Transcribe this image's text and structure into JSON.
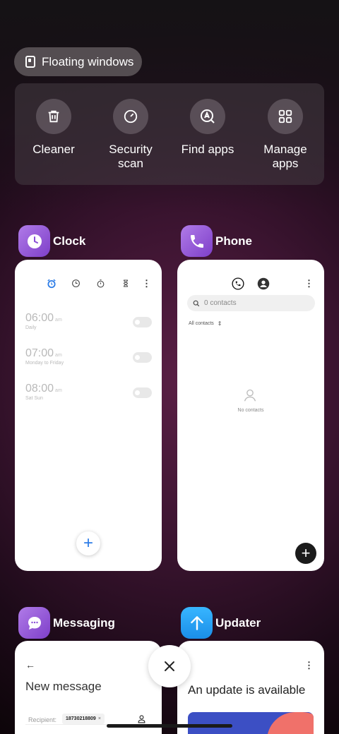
{
  "floating_windows": {
    "label": "Floating windows"
  },
  "tools": [
    {
      "label": "Cleaner",
      "icon": "trash-icon"
    },
    {
      "label": "Security scan",
      "line1": "Security",
      "line2": "scan",
      "icon": "security-scan-icon"
    },
    {
      "label": "Find apps",
      "icon": "find-apps-icon"
    },
    {
      "label": "Manage apps",
      "line1": "Manage",
      "line2": "apps",
      "icon": "grid-icon"
    }
  ],
  "clock": {
    "app_name": "Clock",
    "icon_color": "#9b5cd8",
    "alarms": [
      {
        "time": "06:00",
        "ampm": "am",
        "repeat": "Daily"
      },
      {
        "time": "07:00",
        "ampm": "am",
        "repeat": "Monday to Friday"
      },
      {
        "time": "08:00",
        "ampm": "am",
        "repeat": "Sat Sun"
      }
    ],
    "add_label": "+",
    "more_label": "⋮"
  },
  "phone": {
    "app_name": "Phone",
    "icon_color": "#9b5cd8",
    "search_placeholder": "0 contacts",
    "filter_label": "All contacts",
    "empty_label": "No contacts",
    "add_label": "+",
    "more_label": "⋮"
  },
  "messaging": {
    "app_name": "Messaging",
    "icon_color": "#9b5cd8",
    "title": "New message",
    "recipient_label": "Recipient:",
    "recipient_value": "18730218809",
    "recipient_remove": "×",
    "back_label": "←"
  },
  "updater": {
    "app_name": "Updater",
    "icon_color": "#1ea3f5",
    "title": "An update is available",
    "more_label": "⋮"
  },
  "colors": {
    "accent": "#2b7be6",
    "card": "#ffffff"
  }
}
